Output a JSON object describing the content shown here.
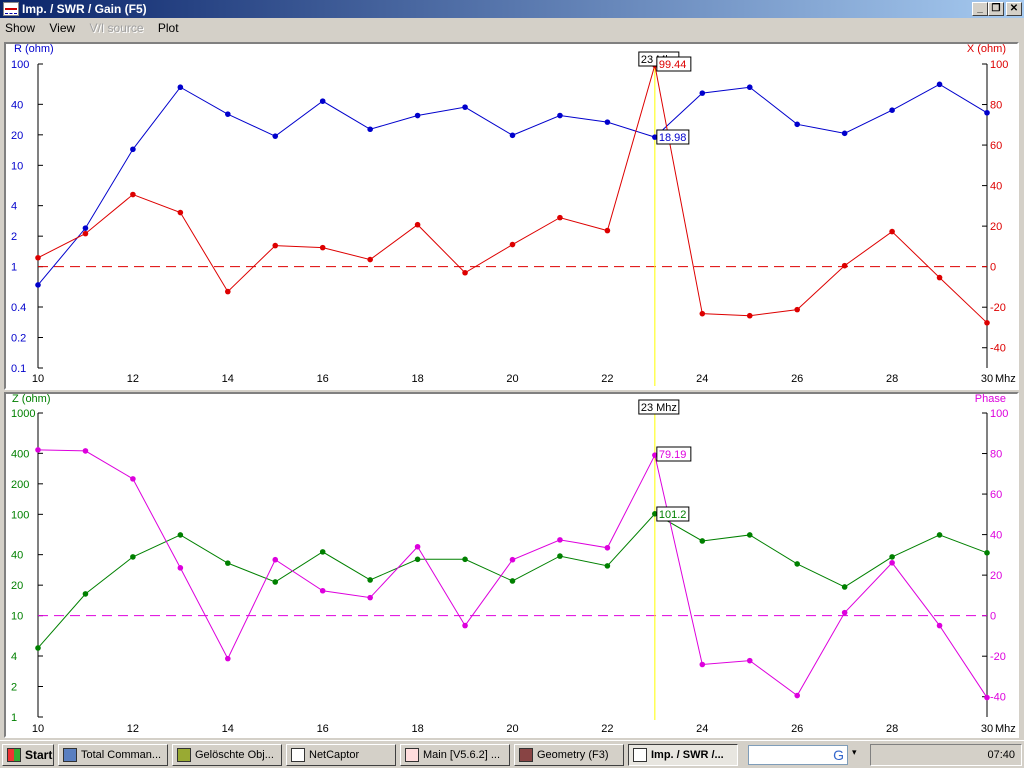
{
  "window": {
    "title": "Imp. / SWR / Gain   (F5)",
    "minimize": "_",
    "maximize": "❐",
    "close": "✕"
  },
  "menu": [
    {
      "label": "Show",
      "enabled": true
    },
    {
      "label": "View",
      "enabled": true
    },
    {
      "label": "V/I source",
      "enabled": false
    },
    {
      "label": "Plot",
      "enabled": true
    }
  ],
  "taskbar": {
    "start": "Start",
    "items": [
      "Total Comman...",
      "Gelöschte Obj...",
      "NetCaptor",
      "Main [V5.6.2] ...",
      "Geometry   (F3)",
      "Imp. / SWR /..."
    ],
    "active": 5,
    "search_logo": "G",
    "clock": "07:40"
  },
  "colors": {
    "r": "#0000cc",
    "x": "#dd0000",
    "z": "#008000",
    "phase": "#dd00dd",
    "cursor": "#ffff00"
  },
  "chart_data": [
    {
      "type": "line",
      "title": "",
      "xlabel": "Mhz",
      "x": [
        10,
        11,
        12,
        13,
        14,
        15,
        16,
        17,
        18,
        19,
        20,
        21,
        22,
        23,
        24,
        25,
        26,
        27,
        28,
        29,
        30
      ],
      "xticks": [
        10,
        12,
        14,
        16,
        18,
        20,
        22,
        24,
        26,
        28,
        30
      ],
      "left_axis": {
        "label": "R (ohm)",
        "scale": "log",
        "range": [
          0.1,
          100
        ],
        "ticks": [
          100,
          40,
          20,
          10,
          4,
          2,
          1,
          0.4,
          0.2,
          0.1
        ]
      },
      "right_axis": {
        "label": "X (ohm)",
        "scale": "linear",
        "range": [
          -50,
          100
        ],
        "ticks": [
          100,
          80,
          60,
          40,
          20,
          0,
          -20,
          -40
        ]
      },
      "series": [
        {
          "name": "R (ohm)",
          "axis": "left",
          "values": [
            0.66,
            2.4,
            14.4,
            59,
            32,
            19.4,
            43,
            22.7,
            31,
            37.5,
            19.8,
            31,
            26.7,
            18.98,
            51.6,
            59,
            25.4,
            20.7,
            35,
            63,
            33
          ]
        },
        {
          "name": "X (ohm)",
          "axis": "right",
          "values": [
            4.4,
            16.3,
            35.6,
            26.7,
            -12.3,
            10.4,
            9.4,
            3.5,
            20.7,
            -3,
            10.9,
            24.2,
            17.8,
            99.44,
            -23.2,
            -24.2,
            -21.2,
            0.5,
            17.3,
            -5.4,
            -27.7
          ]
        }
      ],
      "cursor": {
        "x": 23,
        "label": "23 Mhz",
        "readouts": [
          "99.44",
          "18.98"
        ]
      }
    },
    {
      "type": "line",
      "title": "",
      "xlabel": "Mhz",
      "x": [
        10,
        11,
        12,
        13,
        14,
        15,
        16,
        17,
        18,
        19,
        20,
        21,
        22,
        23,
        24,
        25,
        26,
        27,
        28,
        29,
        30
      ],
      "xticks": [
        10,
        12,
        14,
        16,
        18,
        20,
        22,
        24,
        26,
        28,
        30
      ],
      "left_axis": {
        "label": "Z (ohm)",
        "scale": "log",
        "range": [
          1,
          1000
        ],
        "ticks": [
          1000,
          400,
          200,
          100,
          40,
          20,
          10,
          4,
          2,
          1
        ]
      },
      "right_axis": {
        "label": "Phase",
        "scale": "linear",
        "range": [
          -50,
          100
        ],
        "ticks": [
          100,
          80,
          60,
          40,
          20,
          0,
          -20,
          -40
        ]
      },
      "series": [
        {
          "name": "Z (ohm)",
          "axis": "left",
          "values": [
            4.8,
            16.4,
            38,
            62.6,
            33,
            21.5,
            42.6,
            22.5,
            36,
            36,
            22,
            38.7,
            31,
            101.2,
            54.6,
            62.6,
            32.4,
            19.2,
            38,
            62.6,
            41.7
          ]
        },
        {
          "name": "Phase",
          "axis": "right",
          "values": [
            81.8,
            81.3,
            67.5,
            23.6,
            -21.2,
            27.6,
            12.3,
            8.9,
            34,
            -4.9,
            27.6,
            37.4,
            33.5,
            79.19,
            -24.1,
            -22.2,
            -39.4,
            1.5,
            26.1,
            -4.9,
            -40.4
          ]
        }
      ],
      "cursor": {
        "x": 23,
        "label": "23 Mhz",
        "readouts": [
          "79.19",
          "101.2"
        ]
      }
    }
  ]
}
